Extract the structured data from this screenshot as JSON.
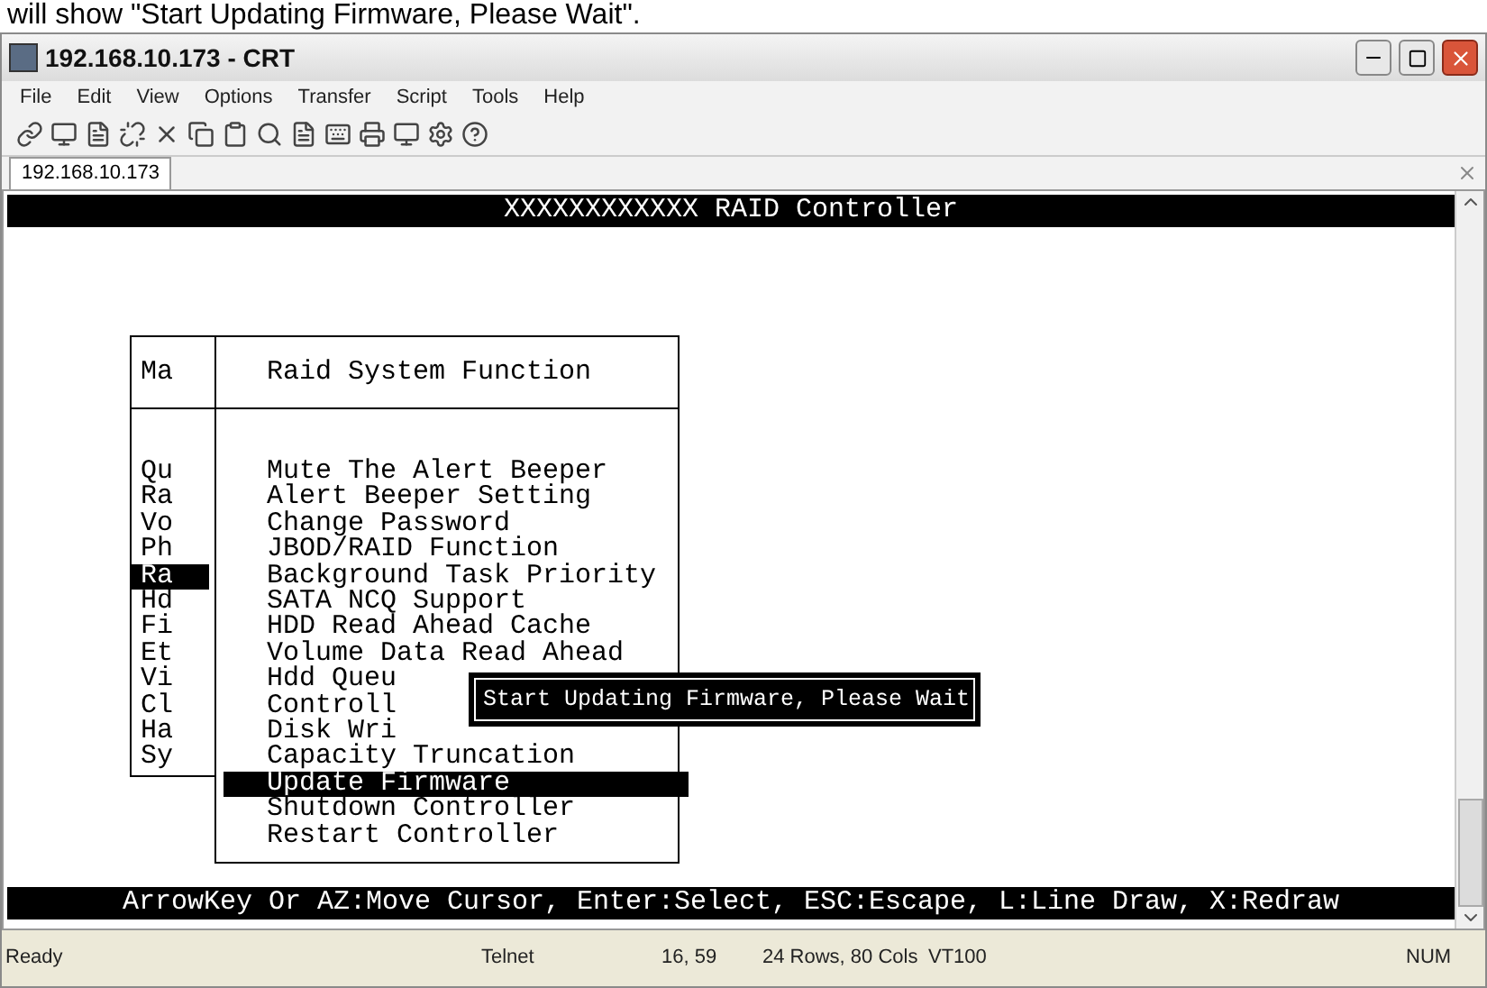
{
  "caption": "will show \"Start Updating Firmware, Please Wait\".",
  "window": {
    "title": "192.168.10.173 - CRT"
  },
  "menu": [
    "File",
    "Edit",
    "View",
    "Options",
    "Transfer",
    "Script",
    "Tools",
    "Help"
  ],
  "session_tab": {
    "label": "192.168.10.173",
    "selected": true
  },
  "terminal": {
    "header": "XXXXXXXXXXXX RAID Controller",
    "main_menu": {
      "title": "Ma",
      "items": [
        {
          "label": "Qu",
          "selected": false
        },
        {
          "label": "Ra",
          "selected": false
        },
        {
          "label": "Vo",
          "selected": false
        },
        {
          "label": "Ph",
          "selected": false
        },
        {
          "label": "Ra",
          "selected": true
        },
        {
          "label": "Hd",
          "selected": false
        },
        {
          "label": "Fi",
          "selected": false
        },
        {
          "label": "Et",
          "selected": false
        },
        {
          "label": "Vi",
          "selected": false
        },
        {
          "label": "Cl",
          "selected": false
        },
        {
          "label": "Ha",
          "selected": false
        },
        {
          "label": "Sy",
          "selected": false
        }
      ]
    },
    "function_menu": {
      "title": "Raid System Function",
      "items": [
        {
          "label": "Mute The Alert Beeper",
          "selected": false
        },
        {
          "label": "Alert Beeper Setting",
          "selected": false
        },
        {
          "label": "Change Password",
          "selected": false
        },
        {
          "label": "JBOD/RAID Function",
          "selected": false
        },
        {
          "label": "Background Task Priority",
          "selected": false
        },
        {
          "label": "SATA NCQ Support",
          "selected": false
        },
        {
          "label": "HDD Read Ahead Cache",
          "selected": false
        },
        {
          "label": "Volume Data Read Ahead",
          "selected": false
        },
        {
          "label": "Hdd Queu",
          "selected": false
        },
        {
          "label": "Controll",
          "selected": false
        },
        {
          "label": "Disk Wri",
          "selected": false
        },
        {
          "label": "Capacity Truncation",
          "selected": false
        },
        {
          "label": "Update Firmware",
          "selected": true
        },
        {
          "label": "Shutdown Controller",
          "selected": false
        },
        {
          "label": "Restart Controller",
          "selected": false
        }
      ]
    },
    "message": "Start Updating Firmware, Please Wait",
    "help_line": "ArrowKey Or AZ:Move Cursor, Enter:Select, ESC:Escape, L:Line Draw, X:Redraw"
  },
  "status_bar": [
    "Ready",
    "Telnet",
    "16, 59",
    "24 Rows, 80 Cols",
    "VT100",
    "NUM"
  ]
}
